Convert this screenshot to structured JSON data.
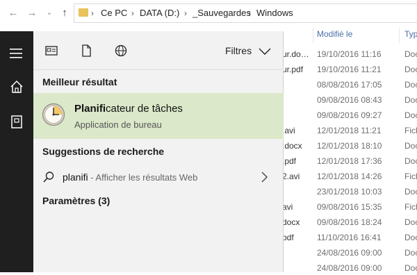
{
  "explorer": {
    "breadcrumbs": [
      "Ce PC",
      "DATA (D:)",
      "_Sauvegardes",
      "Windows"
    ],
    "columns": {
      "modified": "Modifié le",
      "type": "Typ"
    },
    "files": [
      {
        "name": "ur.do…",
        "date": "19/10/2016 11:16",
        "type": "Doc"
      },
      {
        "name": "ur.pdf",
        "date": "19/10/2016 11:21",
        "type": "Doc"
      },
      {
        "name": "",
        "date": "08/08/2016 17:05",
        "type": "Doc"
      },
      {
        "name": "",
        "date": "09/08/2016 08:43",
        "type": "Doc"
      },
      {
        "name": "",
        "date": "09/08/2016 09:27",
        "type": "Doc"
      },
      {
        "name": ".avi",
        "date": "12/01/2018 11:21",
        "type": "Fich"
      },
      {
        "name": ".docx",
        "date": "12/01/2018 18:10",
        "type": "Doc"
      },
      {
        "name": ".pdf",
        "date": "12/01/2018 17:36",
        "type": "Doc"
      },
      {
        "name": "2.avi",
        "date": "12/01/2018 14:26",
        "type": "Fich"
      },
      {
        "name": "",
        "date": "23/01/2018 10:03",
        "type": "Doc"
      },
      {
        "name": "avi",
        "date": "09/08/2016 15:35",
        "type": "Fich"
      },
      {
        "name": "docx",
        "date": "09/08/2016 18:24",
        "type": "Doc"
      },
      {
        "name": "pdf",
        "date": "11/10/2016 16:41",
        "type": "Doc"
      },
      {
        "name": "",
        "date": "24/08/2016 09:00",
        "type": "Doc"
      },
      {
        "name": "",
        "date": "24/08/2016 09:00",
        "type": "Doc"
      }
    ]
  },
  "start_menu": {
    "filters_label": "Filtres",
    "best_match_header": "Meilleur résultat",
    "best_match": {
      "title_bold": "Planifi",
      "title_rest": "cateur de tâches",
      "subtitle": "Application de bureau"
    },
    "suggestions_header": "Suggestions de recherche",
    "suggestion": {
      "query": "planifi",
      "hint": " - Afficher les résultats Web"
    },
    "settings_header": "Paramètres (3)"
  },
  "colors": {
    "rail": "#1f1f1f",
    "panel": "#f2f2f2",
    "best_match_highlight": "#dbe8c9",
    "column_header": "#4a6fa5"
  },
  "icons": [
    "hamburger-icon",
    "home-icon",
    "documents-icon",
    "task-icon",
    "page-icon",
    "globe-icon",
    "chevron-down-icon",
    "search-icon",
    "chevron-right-icon",
    "clock-icon",
    "folder-icon"
  ]
}
